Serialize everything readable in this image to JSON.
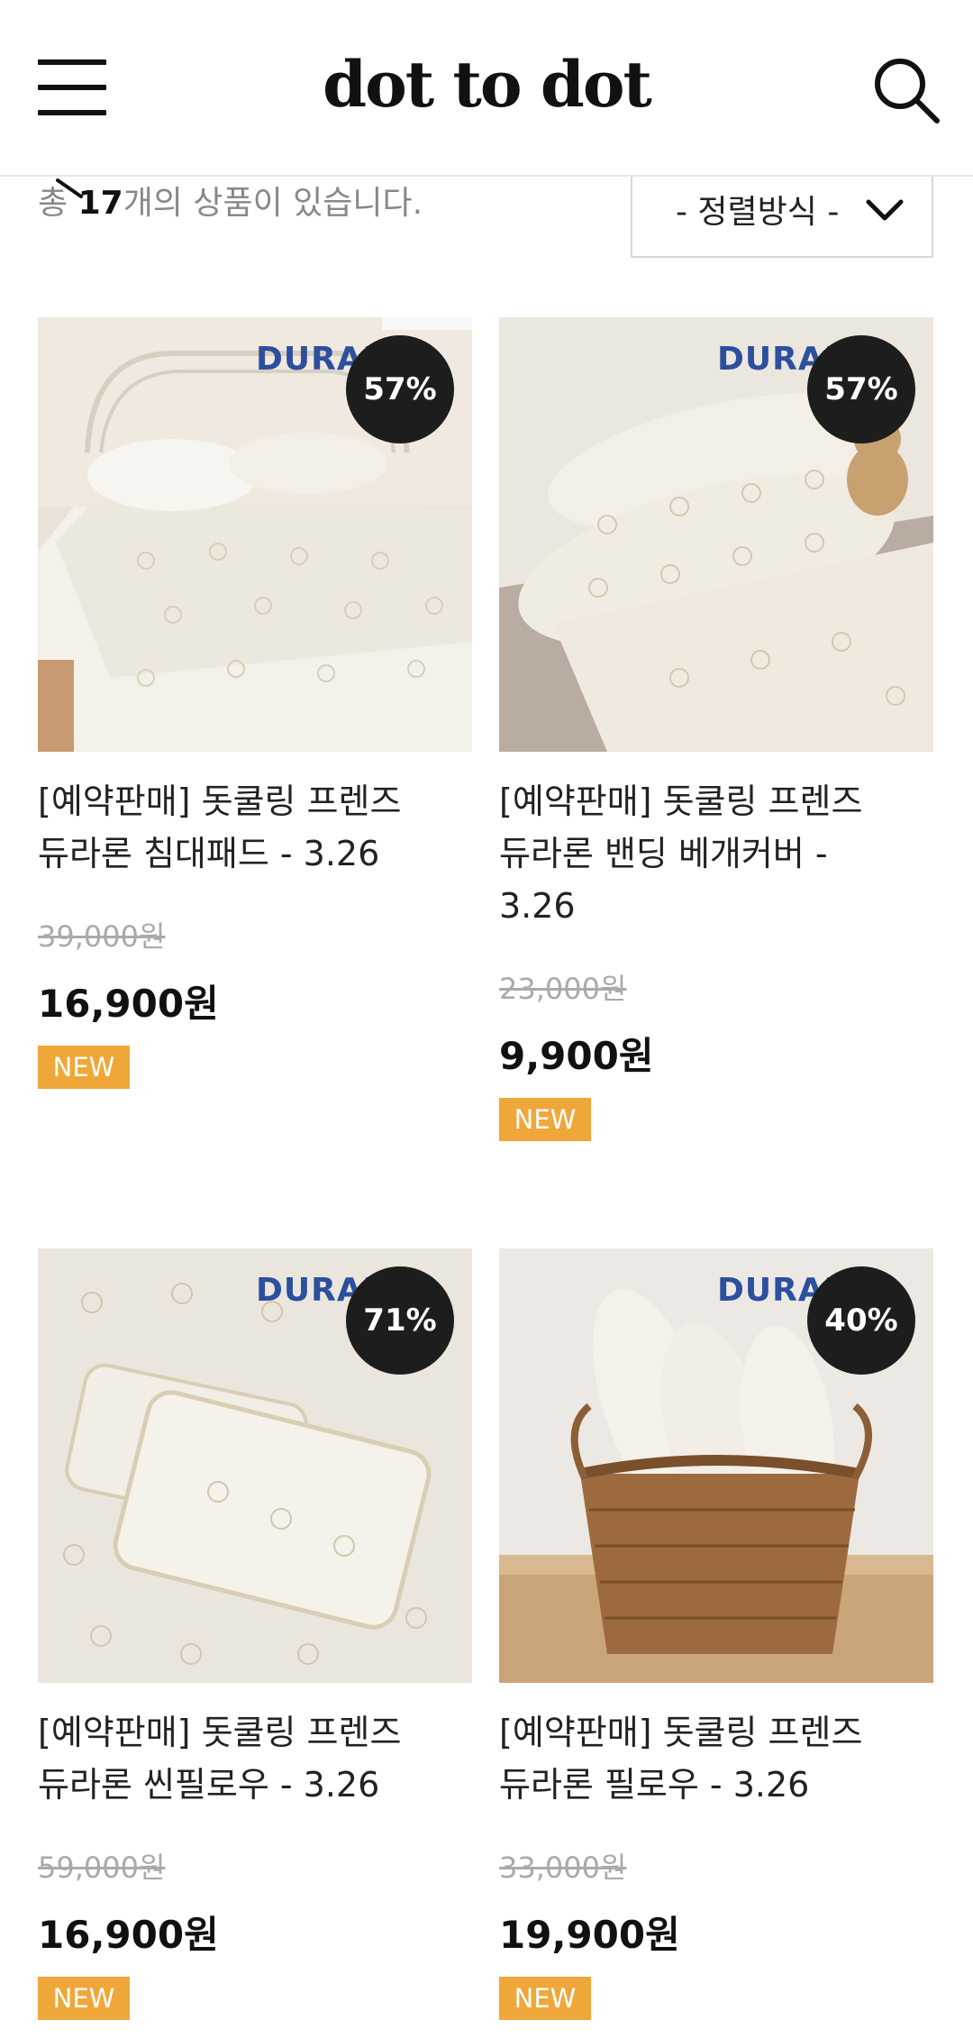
{
  "header": {
    "logo": "dot to dot",
    "menu_icon": "hamburger-icon",
    "search_icon": "search-icon"
  },
  "list_info": {
    "prefix": "총 ",
    "count": "17",
    "suffix": "개의 상품이 있습니다."
  },
  "sort": {
    "label": "- 정렬방식 -",
    "icon": "chevron-down-icon"
  },
  "colors": {
    "discount_badge": "#1d1d1d",
    "new_badge": "#f0a73a",
    "brand": "#2c4f9e"
  },
  "products": [
    {
      "brand": "DURAR",
      "discount": "57%",
      "title_line1": "[예약판매] 돗쿨링 프렌즈",
      "title_line2": "듀라론 침대패드 - 3.26",
      "title_line3": "",
      "old_price": "39,000원",
      "price": "16,900원",
      "badge": "NEW"
    },
    {
      "brand": "DURAR",
      "discount": "57%",
      "title_line1": "[예약판매] 돗쿨링 프렌즈",
      "title_line2": "듀라론 밴딩 베개커버 -",
      "title_line3": "3.26",
      "old_price": "23,000원",
      "price": "9,900원",
      "badge": "NEW"
    },
    {
      "brand": "DURAR",
      "discount": "71%",
      "title_line1": "[예약판매] 돗쿨링 프렌즈",
      "title_line2": "듀라론 씬필로우 - 3.26",
      "title_line3": "",
      "old_price": "59,000원",
      "price": "16,900원",
      "badge": "NEW"
    },
    {
      "brand": "DURAR",
      "discount": "40%",
      "title_line1": "[예약판매] 돗쿨링 프렌즈",
      "title_line2": "듀라론 필로우 - 3.26",
      "title_line3": "",
      "old_price": "33,000원",
      "price": "19,900원",
      "badge": "NEW"
    }
  ]
}
